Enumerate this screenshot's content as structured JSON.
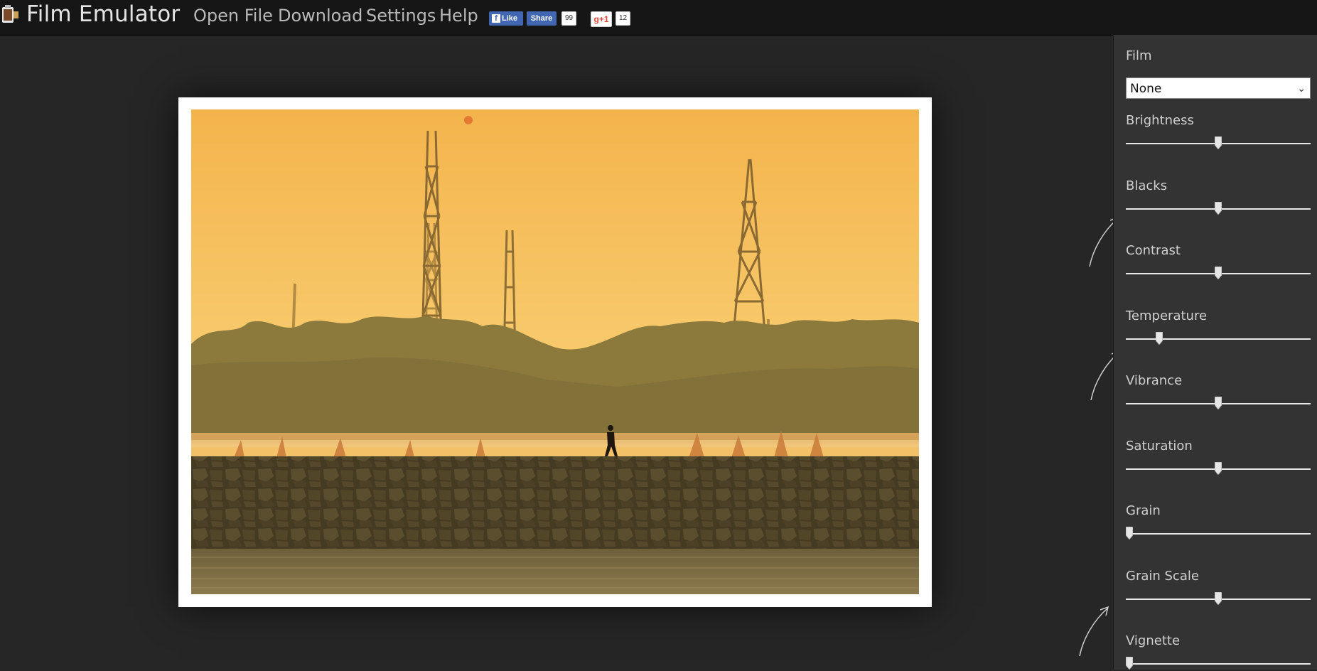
{
  "app": {
    "title": "Film Emulator"
  },
  "nav": {
    "open_file": "Open File",
    "download": "Download",
    "settings": "Settings",
    "help": "Help"
  },
  "social": {
    "fb_like": "Like",
    "fb_share": "Share",
    "fb_count": "99",
    "gplus_label": "g+1",
    "gplus_count": "12"
  },
  "panel": {
    "film_label": "Film",
    "film_selected": "None",
    "sliders": [
      {
        "label": "Brightness",
        "value": 0.5
      },
      {
        "label": "Blacks",
        "value": 0.5
      },
      {
        "label": "Contrast",
        "value": 0.5
      },
      {
        "label": "Temperature",
        "value": 0.18
      },
      {
        "label": "Vibrance",
        "value": 0.5
      },
      {
        "label": "Saturation",
        "value": 0.5
      },
      {
        "label": "Grain",
        "value": 0.02
      },
      {
        "label": "Grain Scale",
        "value": 0.5
      },
      {
        "label": "Vignette",
        "value": 0.02
      }
    ]
  },
  "colors": {
    "topbar": "#161616",
    "background": "#262626",
    "panel": "#333333",
    "sky_top": "#f5b94f",
    "sky_bottom": "#f8cf72"
  }
}
